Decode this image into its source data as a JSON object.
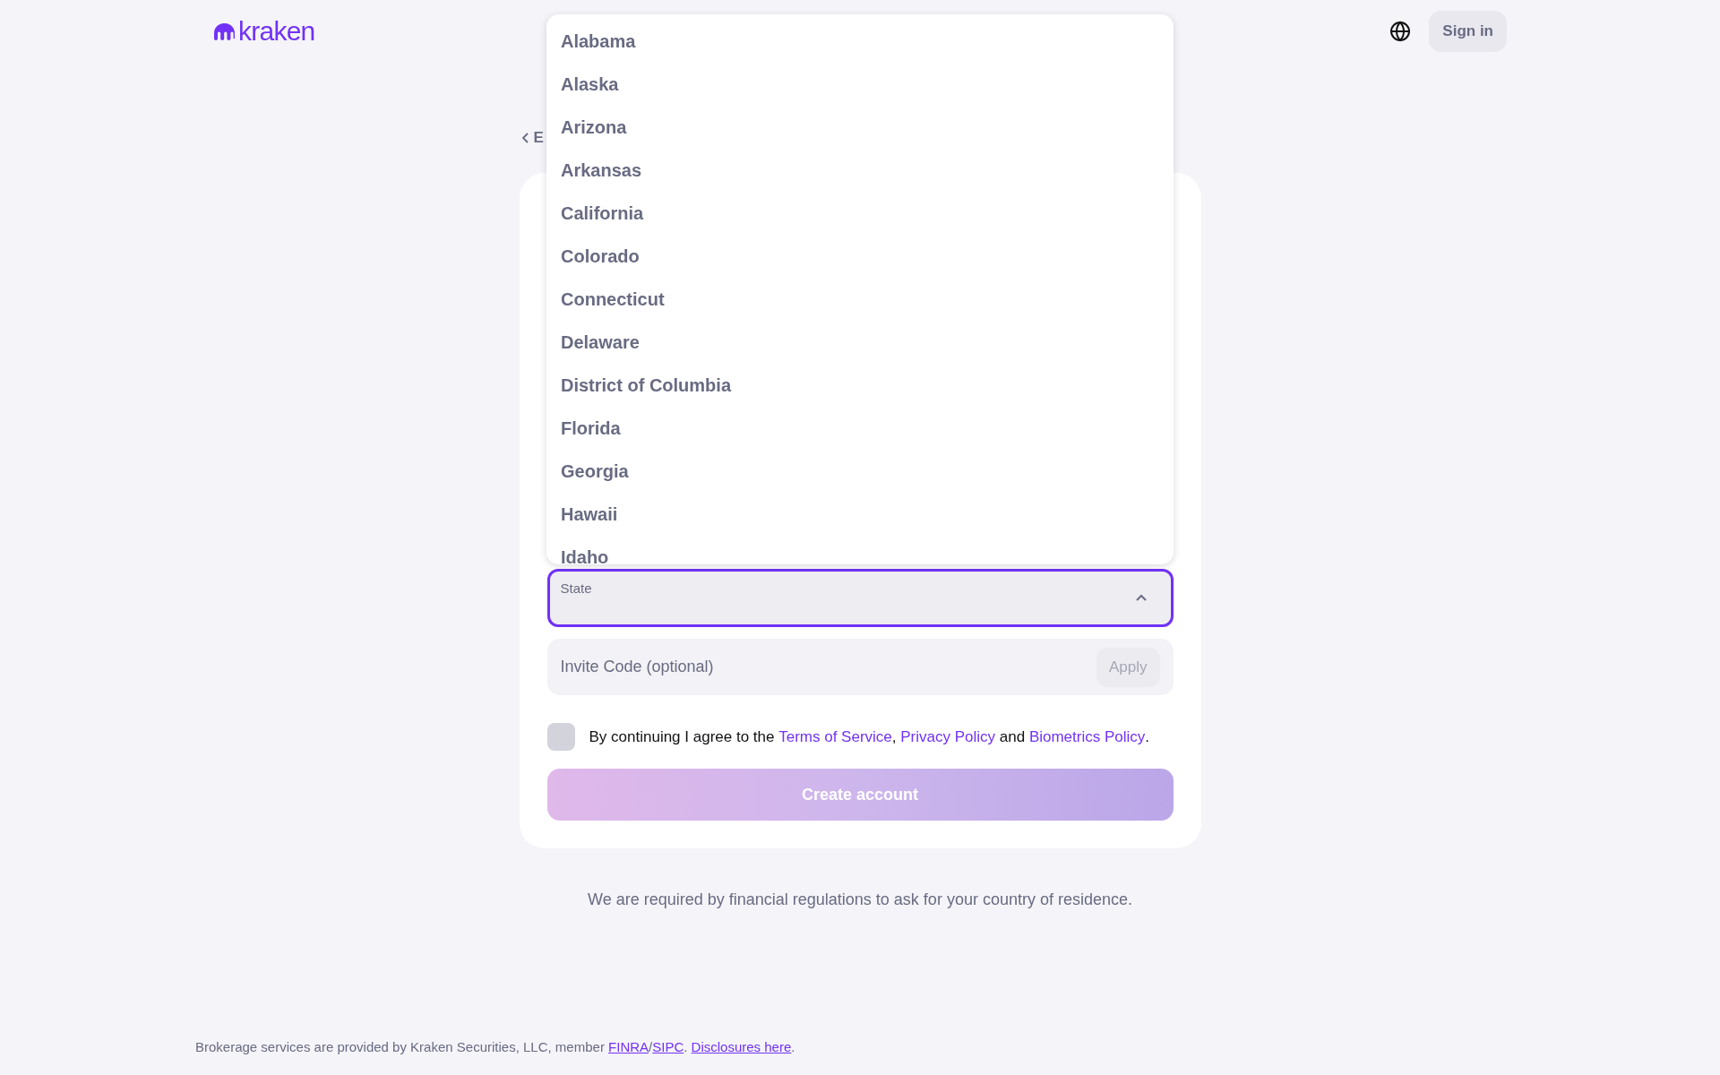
{
  "header": {
    "logo": "kraken",
    "sign_in": "Sign in"
  },
  "back_link": {
    "label": "E"
  },
  "state_dropdown": {
    "options": [
      {
        "label": "Alabama"
      },
      {
        "label": "Alaska"
      },
      {
        "label": "Arizona"
      },
      {
        "label": "Arkansas"
      },
      {
        "label": "California"
      },
      {
        "label": "Colorado"
      },
      {
        "label": "Connecticut"
      },
      {
        "label": "Delaware"
      },
      {
        "label": "District of Columbia"
      },
      {
        "label": "Florida"
      },
      {
        "label": "Georgia"
      },
      {
        "label": "Hawaii"
      },
      {
        "label": "Idaho"
      }
    ],
    "expanded": true
  },
  "state_field": {
    "label": "State"
  },
  "invite_field": {
    "placeholder": "Invite Code (optional)",
    "apply": "Apply"
  },
  "agreement": {
    "checked": false,
    "parts": [
      {
        "kind": "text",
        "text": "By continuing I agree to the "
      },
      {
        "kind": "link",
        "text": "Terms of Service"
      },
      {
        "kind": "text",
        "text": ", "
      },
      {
        "kind": "link",
        "text": "Privacy Policy"
      },
      {
        "kind": "text",
        "text": " and "
      },
      {
        "kind": "link",
        "text": "Biometrics Policy"
      },
      {
        "kind": "text",
        "text": "."
      }
    ]
  },
  "create_button": {
    "label": "Create account",
    "disabled": true
  },
  "note": "We are required by financial regulations to ask for your country of residence.",
  "footer": {
    "parts": [
      {
        "kind": "text",
        "text": "Brokerage services are provided by Kraken Securities, LLC, member "
      },
      {
        "kind": "link",
        "text": "FINRA"
      },
      {
        "kind": "text",
        "text": "/"
      },
      {
        "kind": "link",
        "text": "SIPC"
      },
      {
        "kind": "text",
        "text": ". "
      },
      {
        "kind": "link",
        "text": "Disclosures here"
      },
      {
        "kind": "text",
        "text": "."
      }
    ]
  }
}
